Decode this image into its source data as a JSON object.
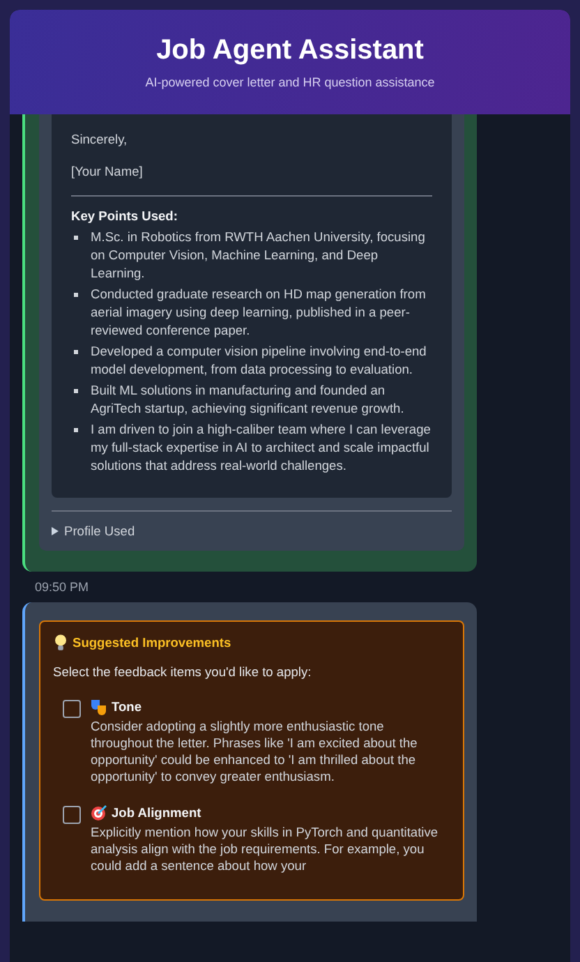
{
  "header": {
    "title": "Job Agent Assistant",
    "subtitle": "AI-powered cover letter and HR question assistance"
  },
  "letter_message": {
    "closing": "Sincerely,",
    "signature": "[Your Name]",
    "key_points_title": "Key Points Used:",
    "key_points": [
      "M.Sc. in Robotics from RWTH Aachen University, focusing on Computer Vision, Machine Learning, and Deep Learning.",
      "Conducted graduate research on HD map generation from aerial imagery using deep learning, published in a peer-reviewed conference paper.",
      "Developed a computer vision pipeline involving end-to-end model development, from data processing to evaluation.",
      "Built ML solutions in manufacturing and founded an AgriTech startup, achieving significant revenue growth.",
      "I am driven to join a high-caliber team where I can leverage my full-stack expertise in AI to architect and scale impactful solutions that address real-world challenges."
    ],
    "profile_toggle": {
      "label": "Profile Used",
      "expanded": false
    },
    "time": "09:50 PM"
  },
  "improvements": {
    "title": "Suggested Improvements",
    "instruction": "Select the feedback items you'd like to apply:",
    "items": [
      {
        "kind": "tone",
        "title": "Tone",
        "text": "Consider adopting a slightly more enthusiastic tone throughout the letter. Phrases like 'I am excited about the opportunity' could be enhanced to 'I am thrilled about the opportunity' to convey greater enthusiasm.",
        "checked": false
      },
      {
        "kind": "alignment",
        "title": "Job Alignment",
        "text": "Explicitly mention how your skills in PyTorch and quantitative analysis align with the job requirements. For example, you could add a sentence about how your",
        "checked": false
      }
    ]
  }
}
